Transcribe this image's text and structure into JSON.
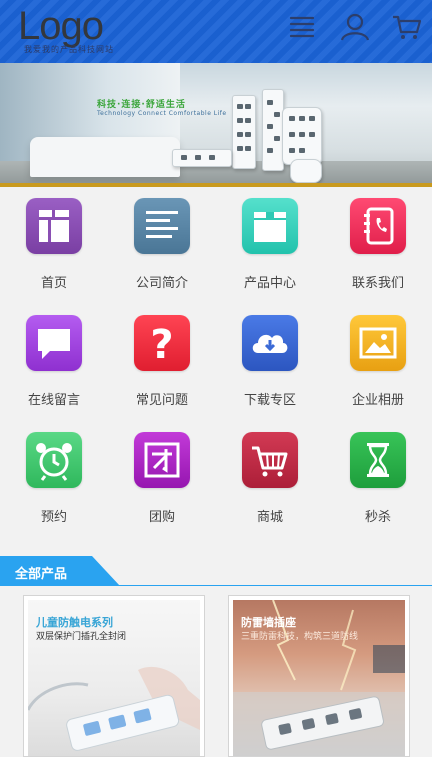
{
  "header": {
    "logo_text": "Logo",
    "logo_subtitle": "我爱我的产品科技网站",
    "icons": [
      "menu-icon",
      "user-icon",
      "cart-icon"
    ],
    "color": "#1b63d6"
  },
  "banner": {
    "slogan": "科技·连接·舒适生活",
    "slogan_en": "Technology Connect Comfortable Life"
  },
  "nav": [
    {
      "label": "首页",
      "icon": "home-icon",
      "color": "#8a4fb3"
    },
    {
      "label": "公司简介",
      "icon": "document-icon",
      "color": "#5b86a6"
    },
    {
      "label": "产品中心",
      "icon": "box-icon",
      "color": "#3ad6c0"
    },
    {
      "label": "联系我们",
      "icon": "contact-book-icon",
      "color": "#f0325c"
    },
    {
      "label": "在线留言",
      "icon": "message-icon",
      "color": "#a346e0"
    },
    {
      "label": "常见问题",
      "icon": "question-icon",
      "color": "#f23042"
    },
    {
      "label": "下载专区",
      "icon": "cloud-download-icon",
      "color": "#3b6ad6"
    },
    {
      "label": "企业相册",
      "icon": "photo-icon",
      "color": "#f2b324"
    },
    {
      "label": "预约",
      "icon": "alarm-clock-icon",
      "color": "#3fc96c"
    },
    {
      "label": "团购",
      "icon": "group-buy-icon",
      "color": "#b024c6"
    },
    {
      "label": "商城",
      "icon": "shopping-cart-icon",
      "color": "#c32b44"
    },
    {
      "label": "秒杀",
      "icon": "hourglass-icon",
      "color": "#28b048"
    }
  ],
  "section": {
    "title": "全部产品",
    "color": "#2aa3f0"
  },
  "products": [
    {
      "title": "儿童防触电系列",
      "subtitle": "双层保护门插孔全封闭"
    },
    {
      "title": "防雷墙插座",
      "subtitle": "三重防雷科技，构筑三道防线"
    }
  ]
}
